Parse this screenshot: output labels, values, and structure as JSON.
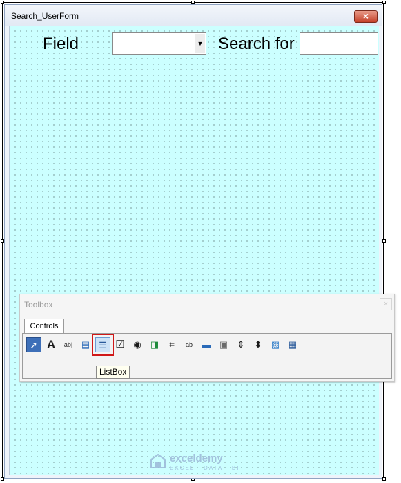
{
  "window": {
    "title": "Search_UserForm",
    "close_glyph": "×"
  },
  "form": {
    "background_color": "#ccffff",
    "field_label": "Field",
    "field_combo_value": "",
    "combo_arrow_glyph": "▼",
    "search_label": "Search for",
    "search_value": ""
  },
  "toolbox": {
    "title": "Toolbox",
    "close_glyph": "×",
    "tab_label": "Controls",
    "tools": [
      {
        "name": "pointer",
        "glyph": "➚"
      },
      {
        "name": "label",
        "glyph": "A"
      },
      {
        "name": "textbox",
        "glyph": "ab|"
      },
      {
        "name": "combobox",
        "glyph": "▤"
      },
      {
        "name": "listbox",
        "glyph": "☰"
      },
      {
        "name": "checkbox",
        "glyph": "☑"
      },
      {
        "name": "optionbutton",
        "glyph": "◉"
      },
      {
        "name": "togglebutton",
        "glyph": "◨"
      },
      {
        "name": "frame",
        "glyph": "⌗"
      },
      {
        "name": "commandbutton",
        "glyph": "ab"
      },
      {
        "name": "tabstrip",
        "glyph": "▬"
      },
      {
        "name": "multipage",
        "glyph": "▣"
      },
      {
        "name": "scrollbar",
        "glyph": "⇕"
      },
      {
        "name": "spinbutton",
        "glyph": "⬍"
      },
      {
        "name": "image",
        "glyph": "▨"
      },
      {
        "name": "refedit",
        "glyph": "▦"
      }
    ],
    "tooltip": "ListBox",
    "highlight_color": "#d01818"
  },
  "watermark": {
    "brand": "exceldemy",
    "tagline": "EXCEL · DATA · BI"
  }
}
